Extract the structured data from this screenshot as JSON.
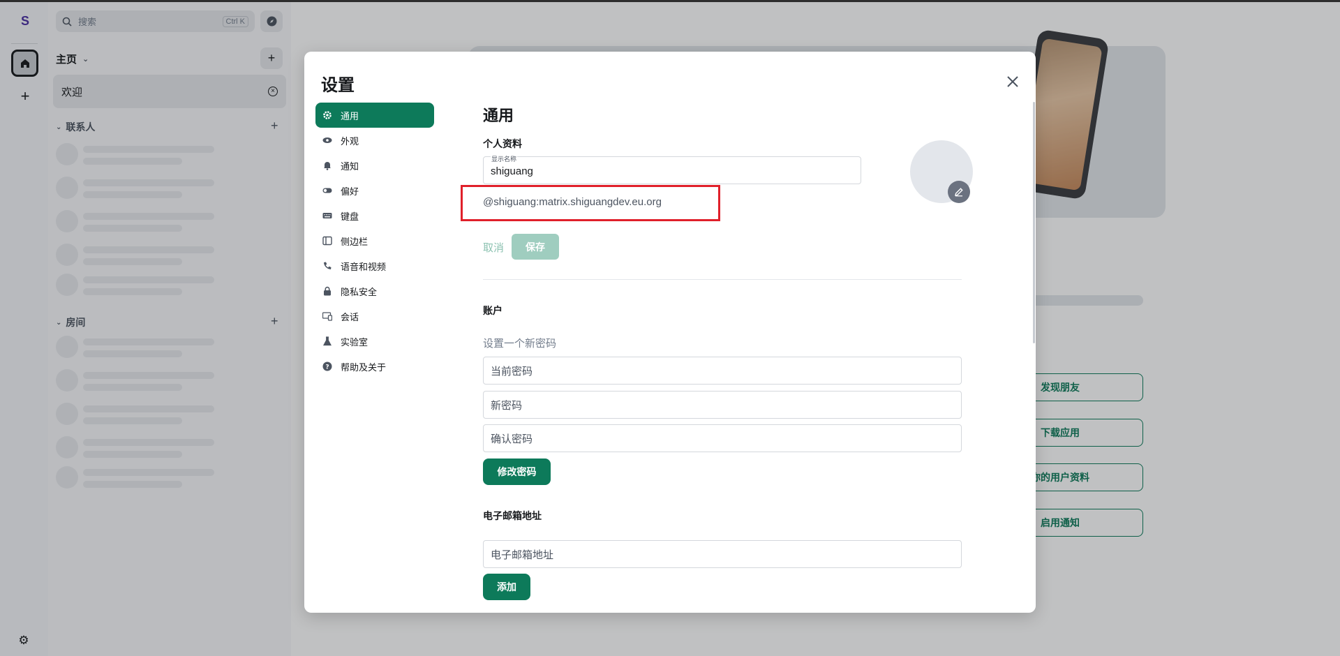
{
  "spaces": {
    "avatar_letter": "S"
  },
  "roomlist": {
    "search_placeholder": "搜索",
    "search_shortcut": "Ctrl K",
    "home_label": "主页",
    "welcome_room": "欢迎",
    "contacts_header": "联系人",
    "rooms_header": "房间"
  },
  "home_actions": [
    "发现朋友",
    "下载应用",
    "你的用户资料",
    "启用通知"
  ],
  "dialog": {
    "title": "设置",
    "tabs": [
      {
        "label": "通用",
        "icon": "gear-icon"
      },
      {
        "label": "外观",
        "icon": "eye-icon"
      },
      {
        "label": "通知",
        "icon": "bell-icon"
      },
      {
        "label": "偏好",
        "icon": "toggle-icon"
      },
      {
        "label": "键盘",
        "icon": "keyboard-icon"
      },
      {
        "label": "侧边栏",
        "icon": "sidebar-icon"
      },
      {
        "label": "语音和视频",
        "icon": "phone-icon"
      },
      {
        "label": "隐私安全",
        "icon": "lock-icon"
      },
      {
        "label": "会话",
        "icon": "devices-icon"
      },
      {
        "label": "实验室",
        "icon": "flask-icon"
      },
      {
        "label": "帮助及关于",
        "icon": "help-icon"
      }
    ],
    "active_tab": "通用",
    "general": {
      "heading": "通用",
      "profile_heading": "个人资料",
      "display_name_label": "显示名称",
      "display_name_value": "shiguang",
      "user_id": "@shiguang:matrix.shiguangdev.eu.org",
      "cancel_label": "取消",
      "save_label": "保存",
      "account_heading": "账户",
      "new_password_label": "设置一个新密码",
      "current_password_placeholder": "当前密码",
      "new_password_placeholder": "新密码",
      "confirm_password_placeholder": "确认密码",
      "change_password_button": "修改密码",
      "email_heading": "电子邮箱地址",
      "email_placeholder": "电子邮箱地址",
      "add_button": "添加"
    }
  },
  "colors": {
    "accent": "#0d7a5a",
    "highlight": "#e0202a"
  }
}
